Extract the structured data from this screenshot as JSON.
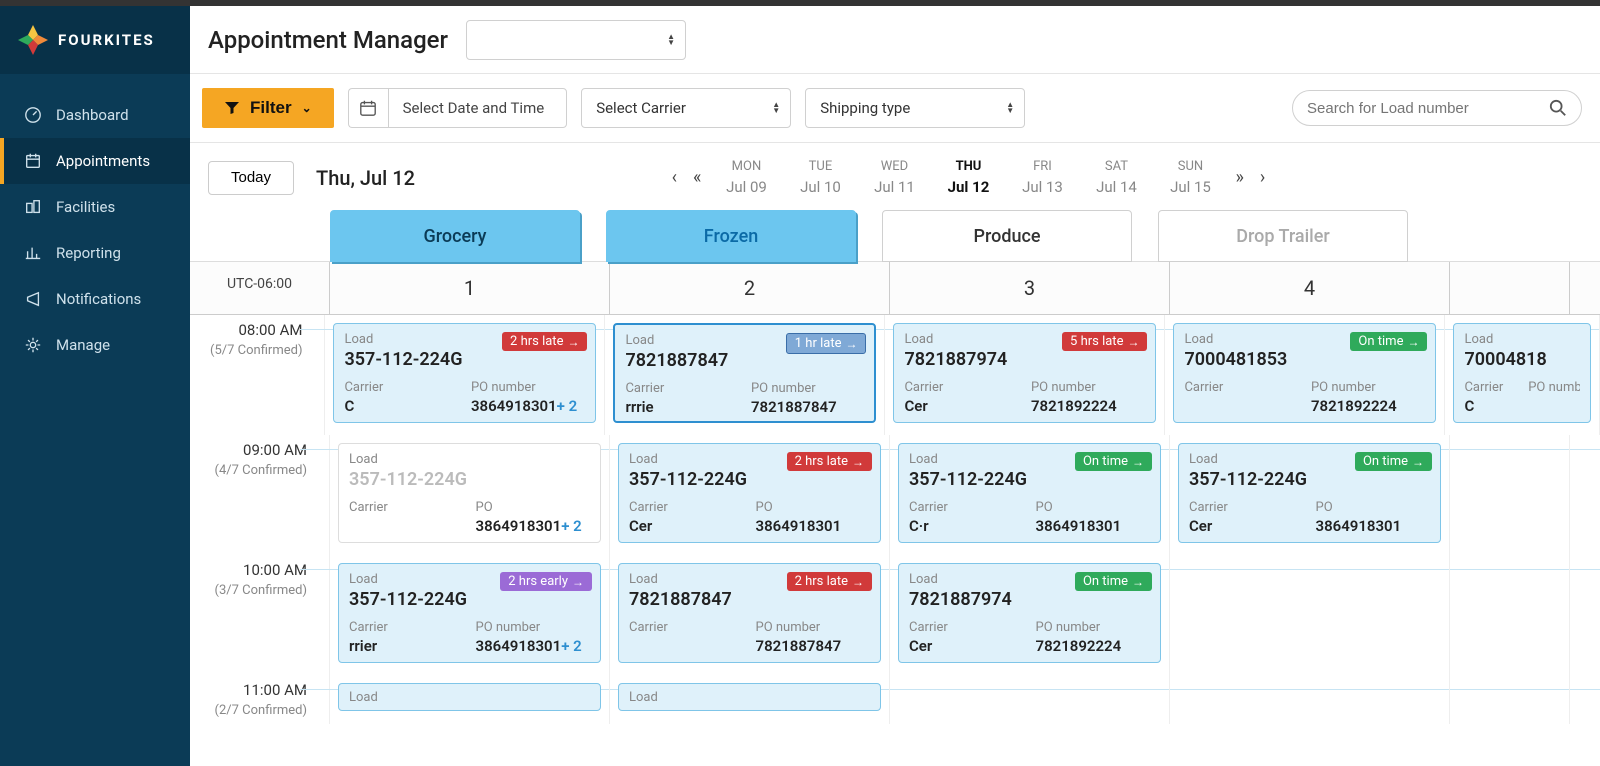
{
  "brand": "FOURKITES",
  "page_title": "Appointment Manager",
  "header_selector_value": "",
  "nav": [
    {
      "label": "Dashboard",
      "active": false
    },
    {
      "label": "Appointments",
      "active": true
    },
    {
      "label": "Facilities",
      "active": false
    },
    {
      "label": "Reporting",
      "active": false
    },
    {
      "label": "Notifications",
      "active": false
    },
    {
      "label": "Manage",
      "active": false
    }
  ],
  "toolbar": {
    "filter_label": "Filter",
    "date_placeholder": "Select Date and Time",
    "carrier_placeholder": "Select Carrier",
    "shipping_placeholder": "Shipping type",
    "search_placeholder": "Search for Load number"
  },
  "date_strip": {
    "today_label": "Today",
    "current_label": "Thu, Jul 12",
    "days": [
      {
        "dow": "MON",
        "date": "Jul 09",
        "active": false
      },
      {
        "dow": "TUE",
        "date": "Jul 10",
        "active": false
      },
      {
        "dow": "WED",
        "date": "Jul 11",
        "active": false
      },
      {
        "dow": "THU",
        "date": "Jul 12",
        "active": true
      },
      {
        "dow": "FRI",
        "date": "Jul 13",
        "active": false
      },
      {
        "dow": "SAT",
        "date": "Jul 14",
        "active": false
      },
      {
        "dow": "SUN",
        "date": "Jul 15",
        "active": false
      }
    ]
  },
  "category_tabs": [
    {
      "label": "Grocery",
      "style": "blue"
    },
    {
      "label": "Frozen",
      "style": "blue2"
    },
    {
      "label": "Produce",
      "style": "white"
    },
    {
      "label": "Drop Trailer",
      "style": "gray"
    }
  ],
  "timezone_label": "UTC-06:00",
  "columns": [
    "1",
    "2",
    "3",
    "4"
  ],
  "rows": [
    {
      "time": "08:00 AM",
      "confirmed": "(5/7 Confirmed)",
      "cells": [
        {
          "load": "357-112-224G",
          "carrier": "C",
          "po": "3864918301",
          "po_extra": "+ 2",
          "badge": {
            "text": "2 hrs late",
            "color": "red"
          }
        },
        {
          "load": "7821887847",
          "carrier": "rrrie",
          "po": "7821887847",
          "badge": {
            "text": "1 hr late",
            "color": "blueframe"
          },
          "selected": true,
          "po_label": "PO number"
        },
        {
          "load": "7821887974",
          "carrier": "Cer",
          "po": "7821892224",
          "badge": {
            "text": "5 hrs late",
            "color": "red"
          },
          "po_label": "PO number"
        },
        {
          "load": "7000481853",
          "carrier": "",
          "po": "7821892224",
          "badge": {
            "text": "On time",
            "color": "green"
          },
          "po_label": "PO number"
        },
        {
          "load": "70004818",
          "carrier": "C",
          "po": "",
          "partial": true
        }
      ]
    },
    {
      "time": "09:00 AM",
      "confirmed": "(4/7 Confirmed)",
      "cells": [
        {
          "load": "357-112-224G",
          "carrier": "",
          "po": "3864918301",
          "po_extra": "+ 2",
          "faded": true,
          "po_label": "PO"
        },
        {
          "load": "357-112-224G",
          "carrier": "Cer",
          "po": "3864918301",
          "badge": {
            "text": "2 hrs late",
            "color": "red"
          },
          "po_label": "PO"
        },
        {
          "load": "357-112-224G",
          "carrier": "C·r",
          "po": "3864918301",
          "badge": {
            "text": "On time",
            "color": "green"
          },
          "po_label": "PO"
        },
        {
          "load": "357-112-224G",
          "carrier": "Cer",
          "po": "3864918301",
          "badge": {
            "text": "On time",
            "color": "green"
          },
          "po_label": "PO"
        }
      ]
    },
    {
      "time": "10:00 AM",
      "confirmed": "(3/7 Confirmed)",
      "cells": [
        {
          "load": "357-112-224G",
          "carrier": "rrier",
          "po": "3864918301",
          "po_extra": "+ 2",
          "badge": {
            "text": "2 hrs early",
            "color": "purple"
          },
          "po_label": "PO number"
        },
        {
          "load": "7821887847",
          "carrier": "",
          "po": "7821887847",
          "badge": {
            "text": "2 hrs late",
            "color": "red"
          },
          "po_label": "PO number"
        },
        {
          "load": "7821887974",
          "carrier": "Cer",
          "po": "7821892224",
          "badge": {
            "text": "On time",
            "color": "green"
          },
          "po_label": "PO number"
        }
      ]
    },
    {
      "time": "11:00 AM",
      "confirmed": "(2/7 Confirmed)",
      "short": true,
      "cells": [
        {
          "short_label": "Load"
        },
        {
          "short_label": "Load"
        }
      ]
    }
  ],
  "labels": {
    "load": "Load",
    "carrier": "Carrier",
    "po": "PO number"
  }
}
